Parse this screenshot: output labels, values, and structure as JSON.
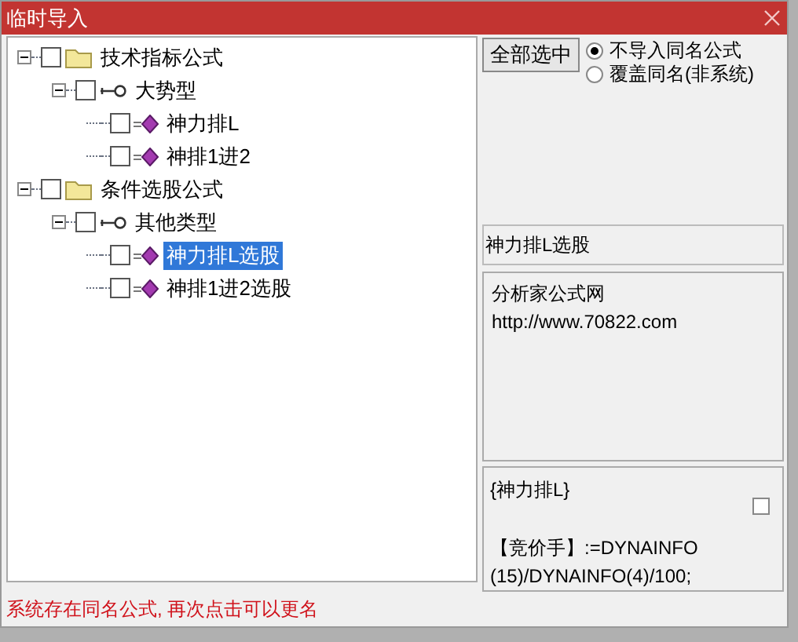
{
  "window": {
    "title": "临时导入"
  },
  "tree": [
    {
      "label": "技术指标公式",
      "kind": "folder",
      "checked": false,
      "expanded": true,
      "selected": false,
      "children": [
        {
          "label": "大势型",
          "kind": "group",
          "checked": false,
          "expanded": true,
          "selected": false,
          "children": [
            {
              "label": "神力排L",
              "kind": "formula",
              "checked": false,
              "selected": false
            },
            {
              "label": "神排1进2",
              "kind": "formula",
              "checked": false,
              "selected": false
            }
          ]
        }
      ]
    },
    {
      "label": "条件选股公式",
      "kind": "folder",
      "checked": false,
      "expanded": true,
      "selected": false,
      "children": [
        {
          "label": "其他类型",
          "kind": "group",
          "checked": false,
          "expanded": true,
          "selected": false,
          "children": [
            {
              "label": "神力排L选股",
              "kind": "formula",
              "checked": false,
              "selected": true
            },
            {
              "label": "神排1进2选股",
              "kind": "formula",
              "checked": false,
              "selected": false
            }
          ]
        }
      ]
    }
  ],
  "select_all_button": "全部选中",
  "options": [
    {
      "label": "不导入同名公式",
      "selected": true
    },
    {
      "label": "覆盖同名(非系统)",
      "selected": false
    }
  ],
  "name_field": "神力排L选股",
  "description": [
    "分析家公式网",
    "http://www.70822.com"
  ],
  "code": {
    "title": "{神力排L}",
    "checked": false,
    "lines": [
      "【竞价手】:=DYNAINFO",
      "(15)/DYNAINFO(4)/100;"
    ]
  },
  "status": "系统存在同名公式, 再次点击可以更名"
}
